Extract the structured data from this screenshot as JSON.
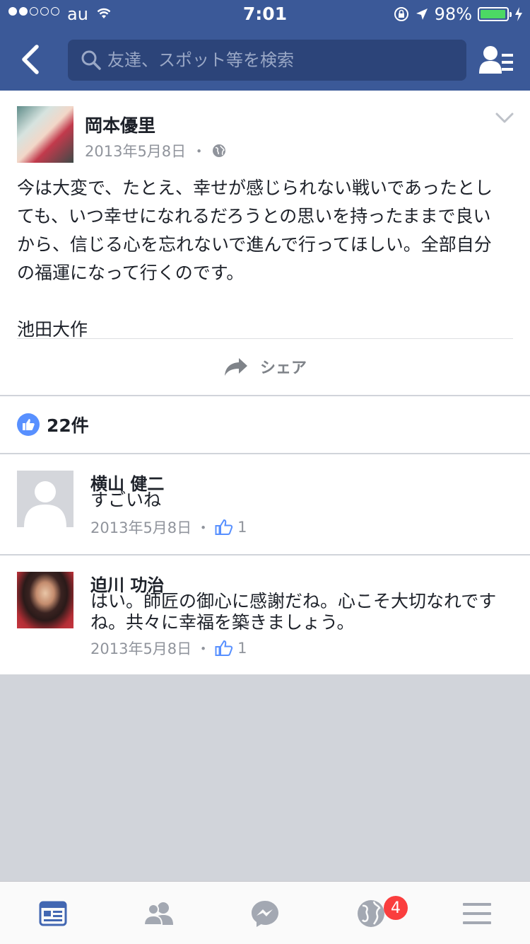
{
  "status_bar": {
    "carrier": "au",
    "time": "7:01",
    "battery": "98%",
    "battery_level": 0.98,
    "signal_bars_filled": 2,
    "signal_bars_total": 5
  },
  "nav": {
    "search_placeholder": "友達、スポット等を検索",
    "accent": "#3b5998"
  },
  "post": {
    "author": "岡本優里",
    "date": "2013年5月8日",
    "separator": "・",
    "body": "今は大変で、たとえ、幸せが感じられない戦いであったとしても、いつ幸せになれるだろうとの思いを持ったままで良いから、信じる心を忘れないで進んで行ってほしい。全部自分の福運になって行くのです。\n\n池田大作",
    "share_label": "シェア"
  },
  "likes": {
    "count": "22件"
  },
  "comments": [
    {
      "name": "横山 健二",
      "text": "すごいね",
      "date": "2013年5月8日",
      "separator": "・",
      "likes": "1"
    },
    {
      "name": "迫川 功治",
      "text": "はい。師匠の御心に感謝だね。心こそ大切なれですね。共々に幸福を築きましょう。",
      "date": "2013年5月8日",
      "separator": "・",
      "likes": "1"
    }
  ],
  "tabbar": {
    "tabs": [
      {
        "icon": "news-feed-icon",
        "active": true
      },
      {
        "icon": "friends-icon",
        "active": false
      },
      {
        "icon": "messenger-icon",
        "active": false
      },
      {
        "icon": "notifications-globe-icon",
        "active": false
      },
      {
        "icon": "menu-icon",
        "active": false
      }
    ],
    "notifications_badge": "4"
  }
}
